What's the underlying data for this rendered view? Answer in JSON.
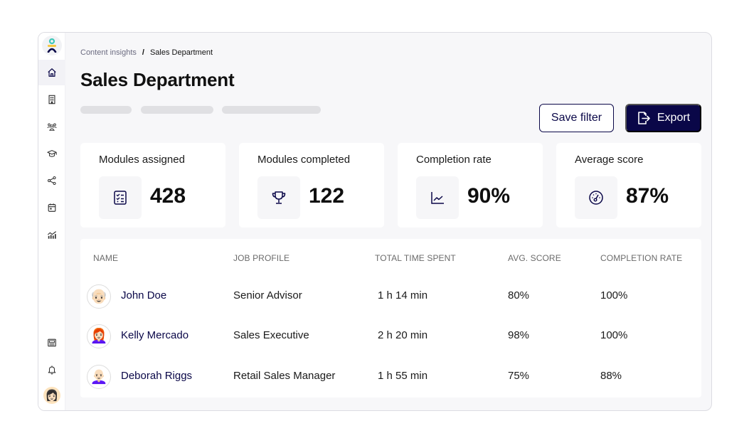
{
  "sidebar": {
    "logo": "brand-logo",
    "items": [
      {
        "name": "home",
        "icon": "home-icon",
        "active": true
      },
      {
        "name": "buildings",
        "icon": "building-icon",
        "active": false
      },
      {
        "name": "users",
        "icon": "users-icon",
        "active": false
      },
      {
        "name": "courses",
        "icon": "graduation-cap-icon",
        "active": false
      },
      {
        "name": "share",
        "icon": "share-icon",
        "active": false
      },
      {
        "name": "calendar",
        "icon": "calendar-icon",
        "active": false
      },
      {
        "name": "analytics",
        "icon": "chart-icon",
        "active": false
      }
    ],
    "bottom_items": [
      {
        "name": "news",
        "icon": "newspaper-icon"
      },
      {
        "name": "notifications",
        "icon": "bell-icon"
      }
    ],
    "user_avatar": "user-avatar"
  },
  "breadcrumb": {
    "parent": "Content insights",
    "separator": "/",
    "current": "Sales Department"
  },
  "header": {
    "title": "Sales Department",
    "save_filter_label": "Save filter",
    "export_label": "Export"
  },
  "colors": {
    "brand": "#0a0748",
    "background": "#f7f7f9",
    "card": "#ffffff",
    "skeleton": "#e0e0e3",
    "logo_teal": "#3ec8b8",
    "logo_yellow": "#f5c842"
  },
  "stats": [
    {
      "label": "Modules assigned",
      "value": "428",
      "icon": "checklist-icon"
    },
    {
      "label": "Modules completed",
      "value": "122",
      "icon": "trophy-icon"
    },
    {
      "label": "Completion rate",
      "value": "90%",
      "icon": "line-chart-icon"
    },
    {
      "label": "Average score",
      "value": "87%",
      "icon": "gauge-icon"
    }
  ],
  "table": {
    "columns": [
      "NAME",
      "JOB PROFILE",
      "TOTAL TIME SPENT",
      "AVG. SCORE",
      "COMPLETION RATE"
    ],
    "rows": [
      {
        "name": "John Doe",
        "job_profile": "Senior Advisor",
        "time_spent": "1 h 14 min",
        "avg_score": "80%",
        "completion_rate": "100%",
        "avatar": "👴🏻"
      },
      {
        "name": "Kelly Mercado",
        "job_profile": "Sales Executive",
        "time_spent": "2 h 20 min",
        "avg_score": "98%",
        "completion_rate": "100%",
        "avatar": "👩🏻‍🦰"
      },
      {
        "name": "Deborah Riggs",
        "job_profile": "Retail Sales Manager",
        "time_spent": "1 h 55 min",
        "avg_score": "75%",
        "completion_rate": "88%",
        "avatar": "👩🏻‍🦲"
      }
    ]
  }
}
